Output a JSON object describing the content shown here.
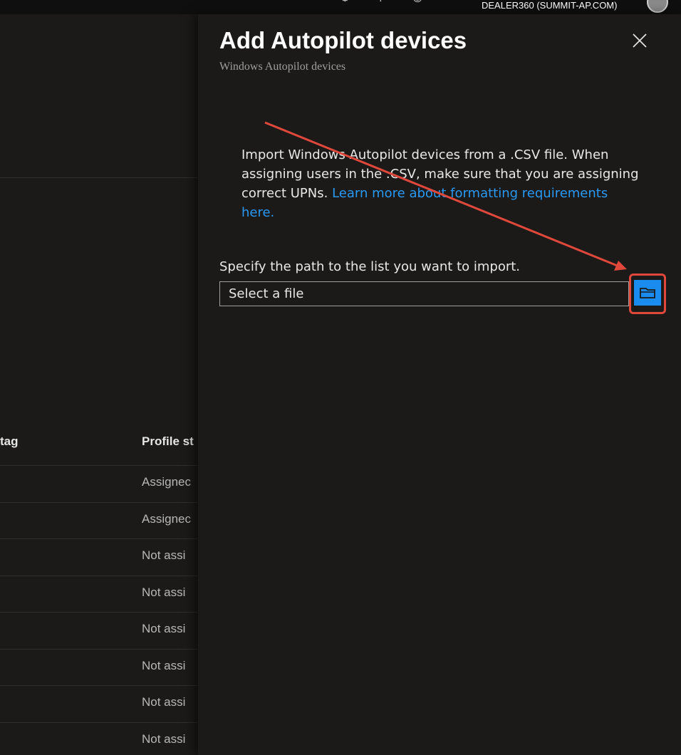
{
  "header": {
    "tenant": "DEALER360 (SUMMIT-AP.COM)"
  },
  "background_table": {
    "columns": [
      "tag",
      "Profile st"
    ],
    "rows": [
      "Assignec",
      "Assignec",
      "Not assi",
      "Not assi",
      "Not assi",
      "Not assi",
      "Not assi",
      "Not assi"
    ]
  },
  "panel": {
    "title": "Add Autopilot devices",
    "subtitle": "Windows Autopilot devices",
    "description": "Import Windows Autopilot devices from a .CSV file. When assigning users in the .CSV, make sure that you are assigning correct UPNs. ",
    "link": "Learn more about formatting requirements here.",
    "path_label": "Specify the path to the list you want to import.",
    "file_placeholder": "Select a file",
    "close_icon": "close-icon",
    "browse_icon": "folder-icon"
  },
  "colors": {
    "accent": "#1a8cf0",
    "link": "#2899f5",
    "highlight": "#e0483b"
  }
}
